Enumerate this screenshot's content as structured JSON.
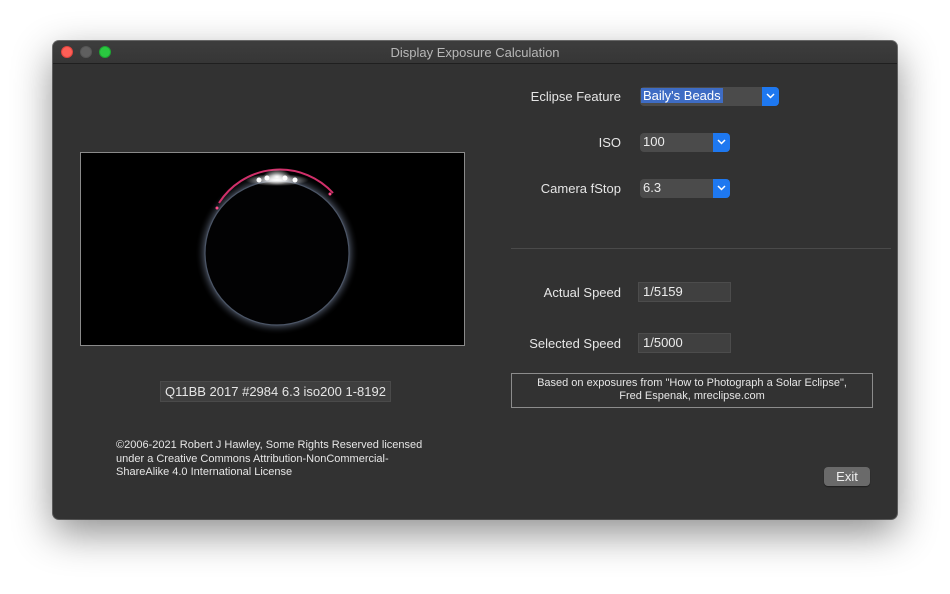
{
  "window": {
    "title": "Display Exposure Calculation"
  },
  "image": {
    "caption": "Q11BB 2017 #2984 6.3 iso200 1-8192"
  },
  "license": {
    "line1": "©2006-2021 Robert J Hawley, Some Rights Reserved licensed",
    "line2": "under a Creative Commons Attribution-NonCommercial-",
    "line3": "ShareAlike 4.0 International License"
  },
  "form": {
    "eclipse_feature": {
      "label": "Eclipse Feature",
      "value": "Baily's Beads"
    },
    "iso": {
      "label": "ISO",
      "value": "100"
    },
    "fstop": {
      "label": "Camera fStop",
      "value": "6.3"
    },
    "actual_speed": {
      "label": "Actual Speed",
      "value": "1/5159"
    },
    "selected_speed": {
      "label": "Selected Speed",
      "value": "1/5000"
    }
  },
  "note": {
    "line1": "Based on exposures from \"How to Photograph a Solar Eclipse\",",
    "line2": "Fred Espenak, mreclipse.com"
  },
  "buttons": {
    "exit": "Exit"
  },
  "icons": {
    "popup_arrow": "chevron-down-icon"
  },
  "colors": {
    "window_bg": "#323232",
    "accent": "#1e78f0",
    "selection": "#3e6cc4"
  }
}
